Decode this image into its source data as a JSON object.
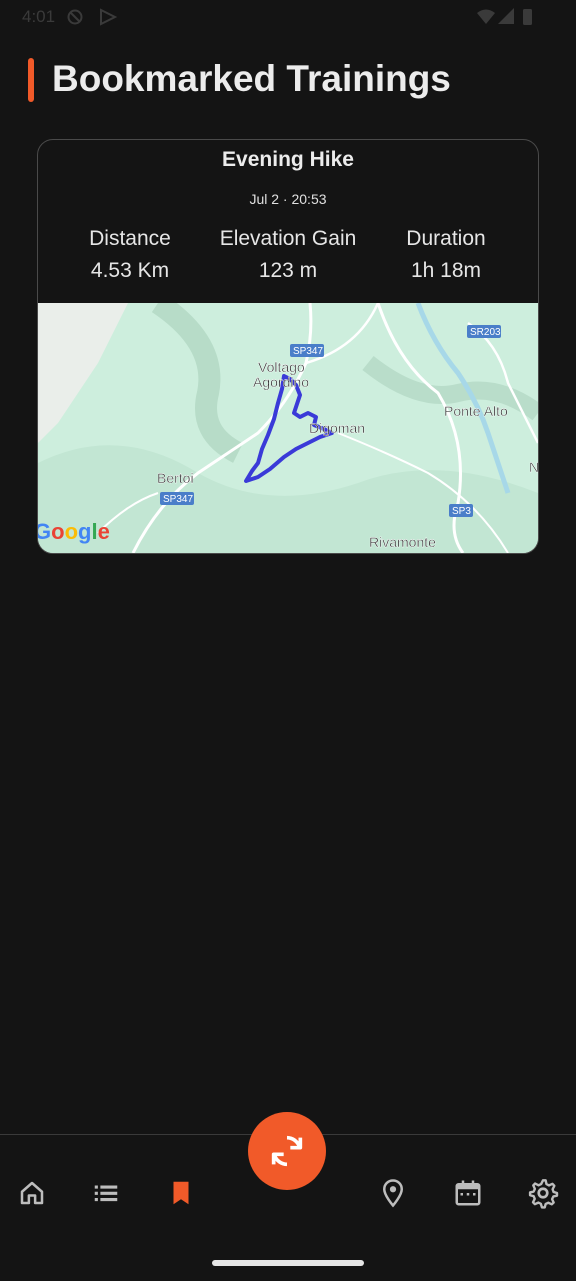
{
  "status_bar": {
    "time": "4:01",
    "icons": [
      "do-not-disturb-icon",
      "play-store-icon",
      "wifi-icon",
      "signal-icon",
      "battery-icon"
    ]
  },
  "header": {
    "title": "Bookmarked Trainings",
    "accent_color": "#f15a29"
  },
  "training": {
    "title": "Evening Hike",
    "date": "Jul 2 · 20:53",
    "stats": {
      "distance_label": "Distance",
      "distance_value": "4.53 Km",
      "elevation_label": "Elevation Gain",
      "elevation_value": "123 m",
      "duration_label": "Duration",
      "duration_value": "1h 18m"
    },
    "map": {
      "place_labels": [
        "Voltago",
        "Agordino",
        "Digoman",
        "Ponte Alto",
        "Bertoi",
        "Rivamonte",
        "N"
      ],
      "road_labels": [
        "SP347",
        "SR203",
        "SP347",
        "SP3"
      ],
      "attribution": "Google",
      "route_color": "#3a3ad8"
    }
  },
  "bottom_nav": {
    "items": [
      "home-icon",
      "list-icon",
      "bookmark-icon",
      "location-icon",
      "calendar-icon",
      "settings-icon"
    ],
    "active": "bookmark-icon",
    "fab_icon": "sync-icon",
    "active_color": "#f15a29"
  }
}
